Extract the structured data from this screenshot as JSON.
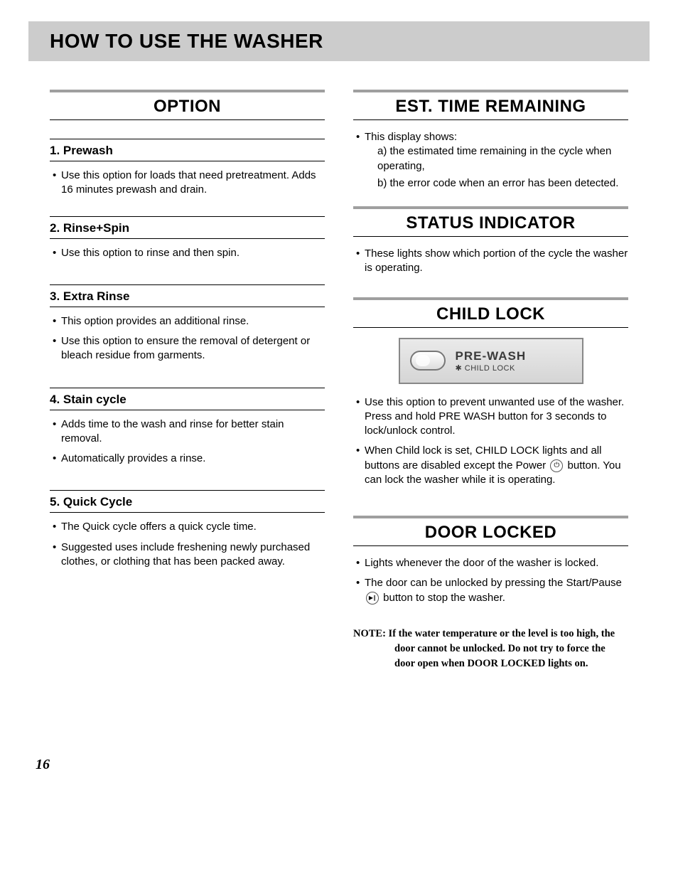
{
  "header": {
    "title": "HOW TO USE THE WASHER"
  },
  "left": {
    "section_title": "OPTION",
    "items": [
      {
        "heading": "1. Prewash",
        "bullets": [
          "Use this option for loads that need pretreatment. Adds 16 minutes prewash and drain."
        ]
      },
      {
        "heading": "2. Rinse+Spin",
        "bullets": [
          "Use this option to rinse and then spin."
        ]
      },
      {
        "heading": "3. Extra Rinse",
        "bullets": [
          "This option provides an additional rinse.",
          "Use this option to ensure the removal of detergent or bleach residue from garments."
        ]
      },
      {
        "heading": "4. Stain cycle",
        "bullets": [
          "Adds time to the wash and rinse for better stain removal.",
          "Automatically provides a rinse."
        ]
      },
      {
        "heading": "5. Quick Cycle",
        "bullets": [
          "The Quick cycle offers a quick cycle time.",
          "Suggested uses include freshening newly purchased clothes, or clothing that has been packed away."
        ]
      }
    ]
  },
  "right": {
    "est_time": {
      "title": "EST. TIME REMAINING",
      "intro": "This display shows:",
      "lines": [
        "a) the estimated time remaining in the cycle when operating,",
        "b) the error code when an error has been detected."
      ]
    },
    "status": {
      "title": "STATUS INDICATOR",
      "bullets": [
        "These lights show which portion of the cycle the washer is operating."
      ]
    },
    "child_lock": {
      "title": "CHILD LOCK",
      "button": {
        "line1": "PRE-WASH",
        "line2": "✱ CHILD LOCK"
      },
      "bullets_pre": "Use this option to prevent unwanted use of the washer. Press and hold PRE WASH button for 3 seconds to lock/unlock control.",
      "bullets_post_a": "When Child lock is set, CHILD LOCK lights and all buttons are disabled except the Power ",
      "bullets_post_b": " button. You can lock the washer while it is operating.",
      "power_icon_label": "⏻"
    },
    "door_locked": {
      "title": "DOOR LOCKED",
      "bullet1": "Lights whenever the door of  the washer is locked.",
      "bullet2a": "The door can be unlocked by pressing the Start/Pause ",
      "bullet2b": " button to stop the washer.",
      "startpause_icon_label": "▶∥",
      "note_label": "NOTE: ",
      "note_body": "If the water temperature or the level is too high, the door cannot be unlocked. Do not try to force the door open when DOOR LOCKED lights on."
    }
  },
  "page_number": "16"
}
